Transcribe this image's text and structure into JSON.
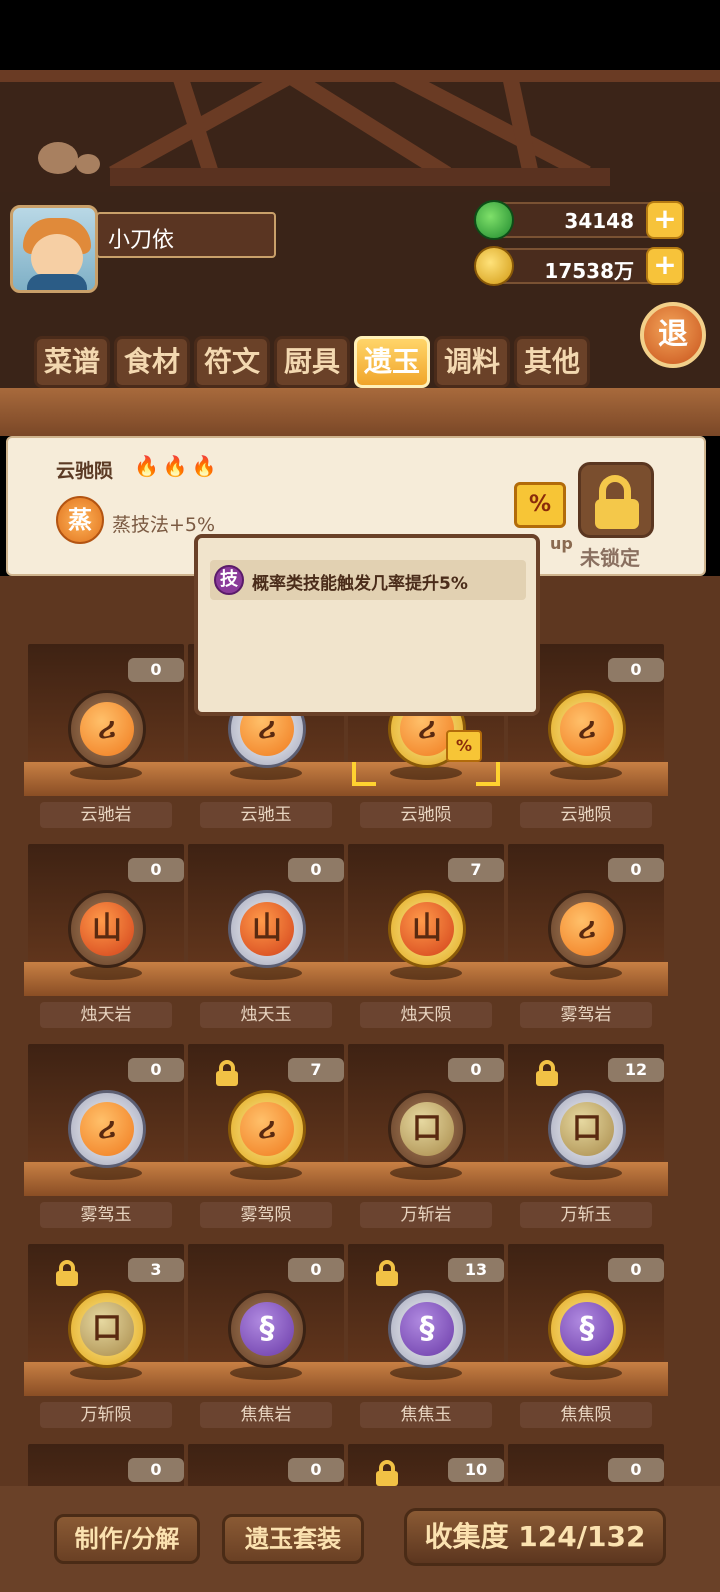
{
  "player": {
    "name": "小刀依",
    "jade": "34148",
    "coins": "17538万"
  },
  "icons": {
    "jade": "green-jade-icon",
    "coin": "gold-coin-icon",
    "plus": "plus-icon",
    "lock": "lock-icon",
    "flame": "flame-icon",
    "percent": "percent-badge-icon"
  },
  "buttons": {
    "plus": "+",
    "exit": "退",
    "craft": "制作/分解",
    "set": "遗玉套装",
    "collection": "收集度 124/132"
  },
  "tabs": [
    {
      "label": "菜谱",
      "active": false
    },
    {
      "label": "食材",
      "active": false
    },
    {
      "label": "符文",
      "active": false
    },
    {
      "label": "厨具",
      "active": false
    },
    {
      "label": "遗玉",
      "active": true
    },
    {
      "label": "调料",
      "active": false
    },
    {
      "label": "其他",
      "active": false
    }
  ],
  "selected_item": {
    "name": "云驰陨",
    "flames": "🔥🔥🔥",
    "skill_glyph": "蒸",
    "skill_text": "蒸技法+5%",
    "percent_badge": "%",
    "up_label": "up",
    "lock_label": "未锁定"
  },
  "tooltip": {
    "glyph": "技",
    "text": "概率类技能触发几率提升5%"
  },
  "grid": [
    {
      "name": "云驰岩",
      "count": "0",
      "rim": "bronze",
      "core": "orange",
      "glyph": "ሪ",
      "locked": false
    },
    {
      "name": "云驰玉",
      "count": "",
      "rim": "silver",
      "core": "orange",
      "glyph": "ሪ",
      "locked": false
    },
    {
      "name": "云驰陨",
      "count": "",
      "rim": "gold",
      "core": "orange",
      "glyph": "ሪ",
      "locked": false
    },
    {
      "name": "云驰陨",
      "count": "0",
      "rim": "gold",
      "core": "orange",
      "glyph": "ሪ",
      "locked": false
    },
    {
      "name": "烛天岩",
      "count": "0",
      "rim": "bronze",
      "core": "red",
      "glyph": "山",
      "locked": false
    },
    {
      "name": "烛天玉",
      "count": "0",
      "rim": "silver",
      "core": "red",
      "glyph": "山",
      "locked": false
    },
    {
      "name": "烛天陨",
      "count": "7",
      "rim": "gold",
      "core": "red",
      "glyph": "山",
      "locked": false
    },
    {
      "name": "雾驾岩",
      "count": "0",
      "rim": "bronze",
      "core": "orange",
      "glyph": "ሪ",
      "locked": false
    },
    {
      "name": "雾驾玉",
      "count": "0",
      "rim": "silver",
      "core": "orange",
      "glyph": "ሪ",
      "locked": false
    },
    {
      "name": "雾驾陨",
      "count": "7",
      "rim": "gold",
      "core": "orange",
      "glyph": "ሪ",
      "locked": true
    },
    {
      "name": "万斩岩",
      "count": "0",
      "rim": "bronze",
      "core": "khaki",
      "glyph": "口",
      "locked": false
    },
    {
      "name": "万斩玉",
      "count": "12",
      "rim": "silver",
      "core": "khaki",
      "glyph": "口",
      "locked": true
    },
    {
      "name": "万斩陨",
      "count": "3",
      "rim": "gold",
      "core": "khaki",
      "glyph": "口",
      "locked": true
    },
    {
      "name": "焦焦岩",
      "count": "0",
      "rim": "bronze",
      "core": "purple",
      "glyph": "§",
      "locked": false
    },
    {
      "name": "焦焦玉",
      "count": "13",
      "rim": "silver",
      "core": "purple",
      "glyph": "§",
      "locked": true
    },
    {
      "name": "焦焦陨",
      "count": "0",
      "rim": "gold",
      "core": "purple",
      "glyph": "§",
      "locked": false
    },
    {
      "name": "",
      "count": "0",
      "rim": "",
      "core": "",
      "glyph": "",
      "locked": false
    },
    {
      "name": "",
      "count": "0",
      "rim": "",
      "core": "",
      "glyph": "",
      "locked": false
    },
    {
      "name": "",
      "count": "10",
      "rim": "",
      "core": "",
      "glyph": "",
      "locked": true
    },
    {
      "name": "",
      "count": "0",
      "rim": "",
      "core": "",
      "glyph": "",
      "locked": false
    }
  ]
}
